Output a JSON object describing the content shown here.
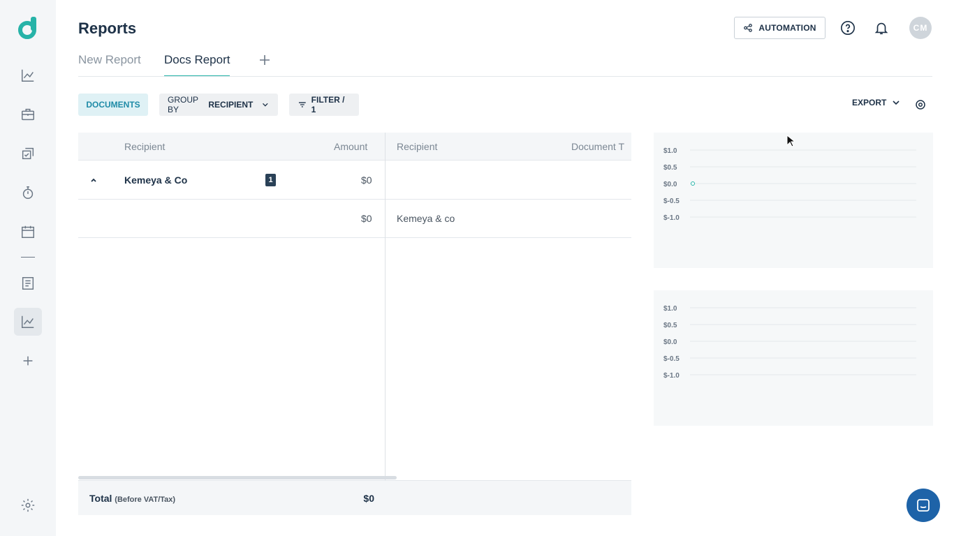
{
  "header": {
    "title": "Reports",
    "automation_label": "AUTOMATION",
    "avatar_initials": "CM"
  },
  "tabs": [
    {
      "label": "New Report",
      "active": false
    },
    {
      "label": "Docs Report",
      "active": true
    }
  ],
  "toolbar": {
    "documents_label": "DOCUMENTS",
    "group_by_prefix": "GROUP BY",
    "group_by_value": "RECIPIENT",
    "filter_label": "FILTER / 1",
    "export_label": "EXPORT"
  },
  "table": {
    "left_columns": [
      "Recipient",
      "Amount"
    ],
    "right_columns": [
      "Recipient",
      "Document T"
    ],
    "group": {
      "name": "Kemeya & Co",
      "count": "1",
      "amount": "$0"
    },
    "rows": [
      {
        "amount": "$0",
        "recipient": "Kemeya & co"
      }
    ],
    "footer": {
      "label": "Total",
      "note": "(Before VAT/Tax)",
      "value": "$0"
    }
  },
  "chart_data": [
    {
      "type": "line",
      "y_ticks": [
        "$1.0",
        "$0.5",
        "$0.0",
        "$-0.5",
        "$-1.0"
      ],
      "ylim": [
        -1.0,
        1.0
      ],
      "series": [
        {
          "values": [
            0
          ]
        }
      ],
      "grid": true
    },
    {
      "type": "line",
      "y_ticks": [
        "$1.0",
        "$0.5",
        "$0.0",
        "$-0.5",
        "$-1.0"
      ],
      "ylim": [
        -1.0,
        1.0
      ],
      "series": [],
      "grid": true
    }
  ],
  "colors": {
    "accent": "#27b3a8",
    "brand": "#1d3147",
    "chat": "#1e63a8"
  }
}
